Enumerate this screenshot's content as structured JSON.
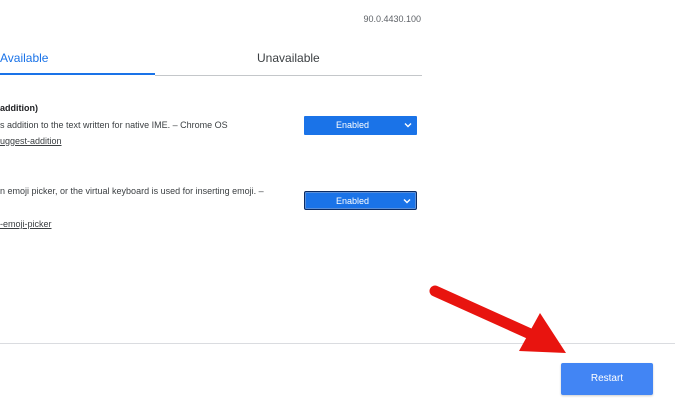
{
  "header": {
    "version": "90.0.4430.100"
  },
  "tabs": [
    {
      "label": "Available"
    },
    {
      "label": "Unavailable"
    }
  ],
  "flags": [
    {
      "title": "addition)",
      "description": "s addition to the text written for native IME. – Chrome OS",
      "link": "uggest-addition",
      "value": "Enabled"
    },
    {
      "description": "n emoji picker, or the virtual keyboard is used for inserting emoji. –",
      "link": "-emoji-picker",
      "value": "Enabled"
    }
  ],
  "footer": {
    "restart_label": "Restart"
  },
  "colors": {
    "accent": "#1a73e8",
    "button": "#4285f4",
    "arrow": "#e8140f"
  },
  "icons": {
    "select_chevron": "chevron-down-icon",
    "annotation": "red-arrow-icon"
  }
}
